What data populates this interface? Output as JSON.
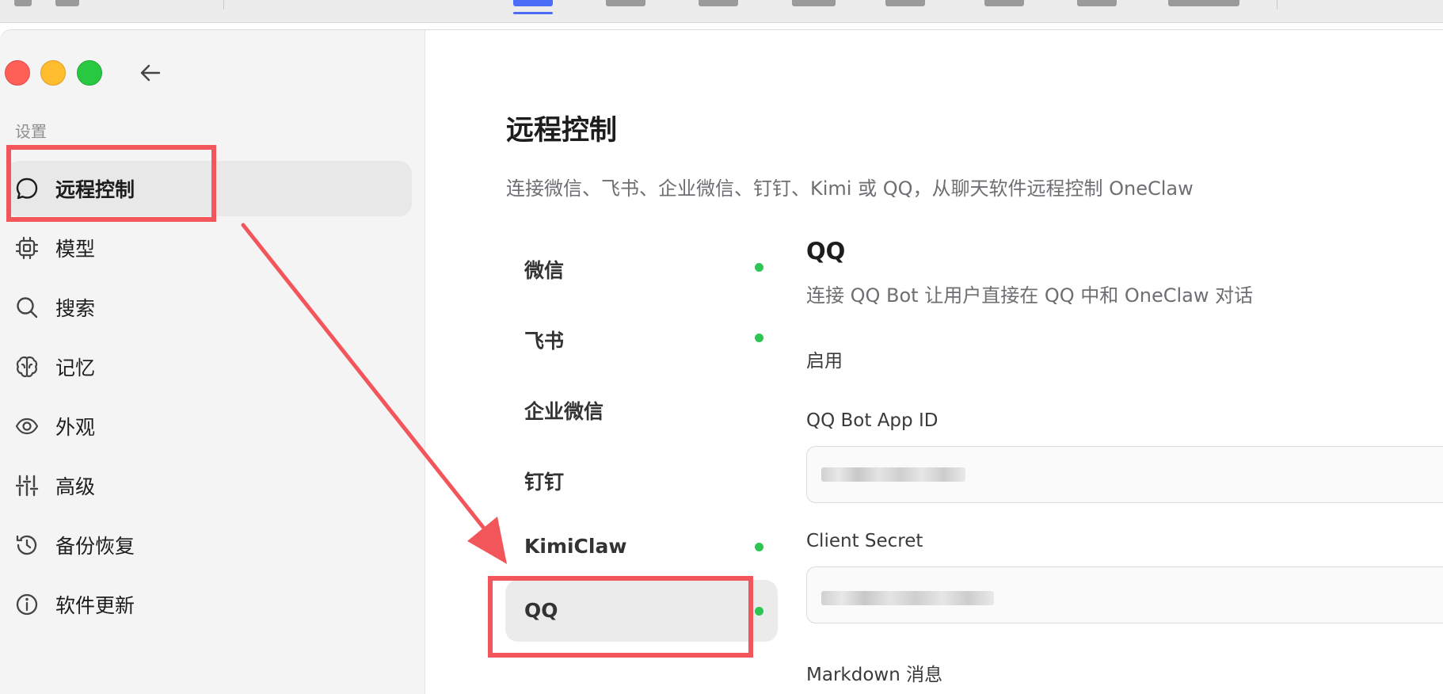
{
  "sidebar": {
    "section_label": "设置",
    "items": [
      {
        "label": "远程控制",
        "icon": "chat-bubble-icon",
        "active": true
      },
      {
        "label": "模型",
        "icon": "chip-icon"
      },
      {
        "label": "搜索",
        "icon": "search-icon"
      },
      {
        "label": "记忆",
        "icon": "brain-icon"
      },
      {
        "label": "外观",
        "icon": "eye-icon"
      },
      {
        "label": "高级",
        "icon": "sliders-icon"
      },
      {
        "label": "备份恢复",
        "icon": "history-icon"
      },
      {
        "label": "软件更新",
        "icon": "info-icon"
      }
    ]
  },
  "main": {
    "title": "远程控制",
    "description": "连接微信、飞书、企业微信、钉钉、Kimi 或 QQ，从聊天软件远程控制 OneClaw",
    "channels": [
      {
        "label": "微信",
        "connected": true
      },
      {
        "label": "飞书",
        "connected": true
      },
      {
        "label": "企业微信",
        "connected": false
      },
      {
        "label": "钉钉",
        "connected": false
      },
      {
        "label": "KimiClaw",
        "connected": true
      },
      {
        "label": "QQ",
        "connected": true,
        "active": true
      }
    ],
    "detail": {
      "title": "QQ",
      "description": "连接 QQ Bot 让用户直接在 QQ 中和 OneClaw 对话",
      "enable_label": "启用",
      "app_id_label": "QQ Bot App ID",
      "client_secret_label": "Client Secret",
      "markdown_label": "Markdown 消息"
    }
  },
  "colors": {
    "accent": "#4a6cf7",
    "status_dot": "#2dc653",
    "annotation": "#f2565a",
    "traffic_red": "#fe5f57",
    "traffic_yellow": "#febc2e",
    "traffic_green": "#28c840"
  }
}
